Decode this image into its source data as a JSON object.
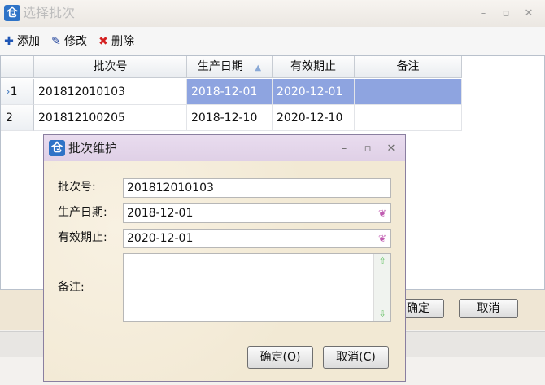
{
  "main_window": {
    "title": "选择批次",
    "app_icon": "仓",
    "controls": {
      "minimize": "–",
      "maximize": "▫",
      "close": "✕"
    },
    "toolbar": {
      "add": "添加",
      "edit": "修改",
      "delete": "删除"
    },
    "grid": {
      "columns": [
        "批次号",
        "生产日期",
        "有效期止",
        "备注"
      ],
      "sort_column": "生产日期",
      "sort_indicator": "▲",
      "rows": [
        {
          "index": "1",
          "batch": "201812010103",
          "production_date": "2018-12-01",
          "expiry_date": "2020-12-01",
          "note": "",
          "selected": true
        },
        {
          "index": "2",
          "batch": "201812100205",
          "production_date": "2018-12-10",
          "expiry_date": "2020-12-10",
          "note": "",
          "selected": false
        }
      ],
      "row_marker": "›"
    },
    "buttons": {
      "ok": "确定",
      "cancel": "取消"
    }
  },
  "dialog": {
    "title": "批次维护",
    "app_icon": "仓",
    "controls": {
      "minimize": "–",
      "maximize": "▫",
      "close": "✕"
    },
    "labels": {
      "batch": "批次号:",
      "production_date": "生产日期:",
      "expiry_date": "有效期止:",
      "note": "备注:"
    },
    "values": {
      "batch": "201812010103",
      "production_date": "2018-12-01",
      "expiry_date": "2020-12-01",
      "note": ""
    },
    "buttons": {
      "ok": "确定(O)",
      "cancel": "取消(C)"
    }
  },
  "colors": {
    "selection": "#8ea4e0",
    "accent": "#2e73c7",
    "dialog_bg": "#f4ecd8"
  },
  "icons": {
    "add": "plus-icon",
    "edit": "pen-icon",
    "delete": "x-icon",
    "date_picker": "butterfly-icon"
  }
}
